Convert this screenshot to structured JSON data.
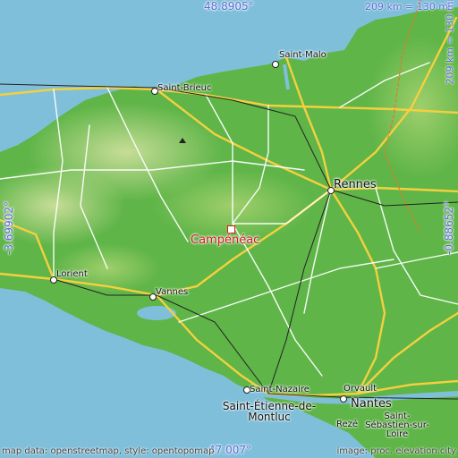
{
  "coordinates": {
    "north": "48.8905°",
    "south": "47.007°",
    "west": "-3.69902°",
    "east": "-0.88652°"
  },
  "scale": {
    "top": "209 km = 130 mi",
    "right": "209 km = 130 mi"
  },
  "credits": {
    "left": "map data: openstreetmap, style: opentopomap",
    "right": "image: proc. elevation.city"
  },
  "highlight": {
    "name": "Campénéac"
  },
  "cities": [
    {
      "name": "Saint-Malo"
    },
    {
      "name": "Saint-Brieuc"
    },
    {
      "name": "Rennes"
    },
    {
      "name": "Lorient"
    },
    {
      "name": "Vannes"
    },
    {
      "name": "Saint-Nazaire"
    },
    {
      "name": "Orvault"
    },
    {
      "name": "Nantes"
    },
    {
      "name": "Saint-Étienne-de-Montluc"
    },
    {
      "name": "Rezé"
    },
    {
      "name": "Saint-Sébastien-sur-Loire"
    }
  ],
  "colors": {
    "sea": "#7fbfd9",
    "lowland": "#4caf3c",
    "upland": "#a9d27e",
    "road_major": "#f4d03f",
    "road_primary": "#ffffff",
    "highlight": "#d41a1a",
    "coord_text": "#5b6bd8"
  }
}
